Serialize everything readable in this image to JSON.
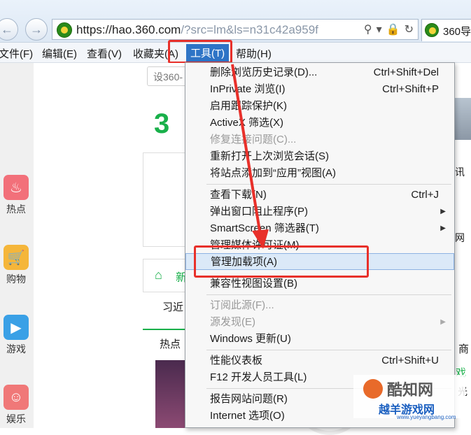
{
  "address_bar": {
    "url_main": "https://hao.360.com",
    "url_query": "/?src=lm&ls=n31c42a959f",
    "tab_label": "360导"
  },
  "menubar": {
    "file": "文件(F)",
    "edit": "编辑(E)",
    "view": "查看(V)",
    "favorites": "收藏夹(A)",
    "tools": "工具(T)",
    "help": "帮助(H)"
  },
  "page": {
    "search_placeholder": "设360-",
    "logo_text": "3",
    "left_rail": [
      {
        "label": "热点",
        "icon": "flame-icon",
        "color": "#f2707a"
      },
      {
        "label": "购物",
        "icon": "cart-icon",
        "color": "#f5b63a"
      },
      {
        "label": "游戏",
        "icon": "gamepad-icon",
        "color": "#3aa0e6"
      },
      {
        "label": "娱乐",
        "icon": "face-icon",
        "color": "#f07878"
      }
    ],
    "card_new": "新",
    "card_hot": "热点",
    "card_xi": "习近",
    "right_snippets": [
      "讯",
      "网",
      "商",
      "戏",
      "光"
    ]
  },
  "tools_menu": {
    "items": [
      {
        "label": "删除浏览历史记录(D)...",
        "shortcut": "Ctrl+Shift+Del"
      },
      {
        "label": "InPrivate 浏览(I)",
        "shortcut": "Ctrl+Shift+P"
      },
      {
        "label": "启用跟踪保护(K)"
      },
      {
        "label": "ActiveX 筛选(X)"
      },
      {
        "label": "修复连接问题(C)...",
        "disabled": true
      },
      {
        "label": "重新打开上次浏览会话(S)"
      },
      {
        "label": "将站点添加到“应用”视图(A)"
      },
      {
        "label": "查看下载(N)",
        "shortcut": "Ctrl+J"
      },
      {
        "label": "弹出窗口阻止程序(P)",
        "submenu": true
      },
      {
        "label": "SmartScreen 筛选器(T)",
        "submenu": true
      },
      {
        "label": "管理媒体许可证(M)"
      },
      {
        "label": "管理加载项(A)",
        "highlight": true
      },
      {
        "label": "兼容性视图设置(B)"
      },
      {
        "label": "订阅此源(F)...",
        "disabled": true
      },
      {
        "label": "源发现(E)",
        "disabled": true,
        "submenu": true
      },
      {
        "label": "Windows 更新(U)"
      },
      {
        "label": "性能仪表板",
        "shortcut": "Ctrl+Shift+U"
      },
      {
        "label": "F12 开发人员工具(L)"
      },
      {
        "label": "报告网站问题(R)"
      },
      {
        "label": "Internet 选项(O)"
      }
    ]
  },
  "watermark": {
    "brand": "酷知网",
    "site": "越羊游戏网",
    "url": "www.yueyangbang.com"
  },
  "colors": {
    "accent_red": "#e8302a",
    "menu_active": "#2e74c6",
    "highlight_bg": "#dbe9f8"
  }
}
